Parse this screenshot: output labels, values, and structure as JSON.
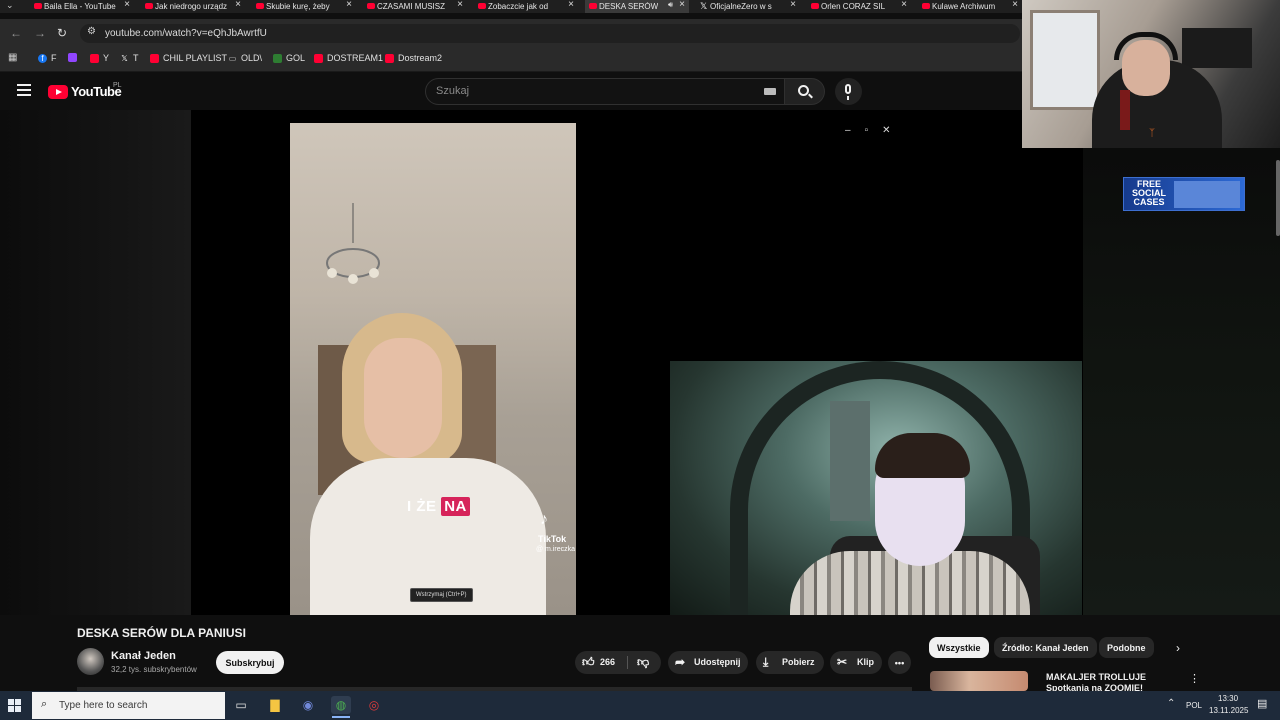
{
  "browser": {
    "tabs": [
      {
        "label": "Baila Ella - YouTube",
        "favicon": "youtube-icon",
        "active": false
      },
      {
        "label": "Jak niedrogo urządzić",
        "favicon": "youtube-icon",
        "active": false
      },
      {
        "label": "Skubie kurę, żeby",
        "favicon": "youtube-icon",
        "active": false
      },
      {
        "label": "CZASAMI MUSISZ",
        "favicon": "youtube-icon",
        "active": false
      },
      {
        "label": "Zobaczcie jak od",
        "favicon": "youtube-icon",
        "active": false
      },
      {
        "label": "DESKA SERÓW",
        "favicon": "youtube-icon",
        "active": true
      },
      {
        "label": "OficjalneZero w s",
        "favicon": "x-icon",
        "active": false
      },
      {
        "label": "Orlen CORAZ SIL",
        "favicon": "youtube-icon",
        "active": false
      },
      {
        "label": "Kulawe Archiwum",
        "favicon": "youtube-icon",
        "active": false
      }
    ],
    "url": "youtube.com/watch?v=eQhJbAwrtfU",
    "bookmarks": [
      {
        "label": "F",
        "icon": "facebook-icon",
        "color": "#1877f2"
      },
      {
        "label": "",
        "icon": "twitch-icon",
        "color": "#9146ff"
      },
      {
        "label": "Y",
        "icon": "youtube-icon",
        "color": "#ff0033"
      },
      {
        "label": "T",
        "icon": "x-icon",
        "color": "#000000"
      },
      {
        "label": "CHIL PLAYLIST",
        "icon": "youtube-icon",
        "color": "#ff0033"
      },
      {
        "label": "OLD\\",
        "icon": "folder-icon",
        "color": "#cccccc"
      },
      {
        "label": "GOL",
        "icon": "gol-icon",
        "color": "#2e7d32"
      },
      {
        "label": "DOSTREAM1",
        "icon": "youtube-icon",
        "color": "#ff0033"
      },
      {
        "label": "Dostream2",
        "icon": "youtube-icon",
        "color": "#ff0033"
      }
    ]
  },
  "youtube": {
    "logo_text": "YouTube",
    "region": "PL",
    "search_placeholder": "Szukaj",
    "player": {
      "tiktok_caption_plain": "I ŻE",
      "tiktok_caption_highlight": "NA",
      "tiktok_brand": "TikTok",
      "tiktok_user": "@ m.ireczka",
      "tooltip": "Wstrzymaj (Ctrl+P)"
    },
    "video_title": "DESKA SERÓW DLA PANIUSI",
    "channel": {
      "name": "Kanał Jeden",
      "subscribers": "32,2 tys. subskrybentów",
      "subscribe_label": "Subskrybuj"
    },
    "actions": {
      "likes": "266",
      "share": "Udostępnij",
      "download": "Pobierz",
      "clip": "Klip"
    },
    "chips": [
      "Wszystkie",
      "Źródło: Kanał Jeden",
      "Podobne"
    ],
    "recommendation": {
      "title": "MAKALJER TROLLUJE Spotkania na ZOOMIE!"
    }
  },
  "overlay_ad": {
    "text": "FREE SOCIAL CASES"
  },
  "taskbar": {
    "search_placeholder": "Type here to search",
    "language": "POL",
    "time": "13:30",
    "date": "13.11.2025"
  },
  "colors": {
    "youtube_red": "#ff0033",
    "background": "#0f0f0f",
    "taskbar": "#1e2a3a"
  }
}
